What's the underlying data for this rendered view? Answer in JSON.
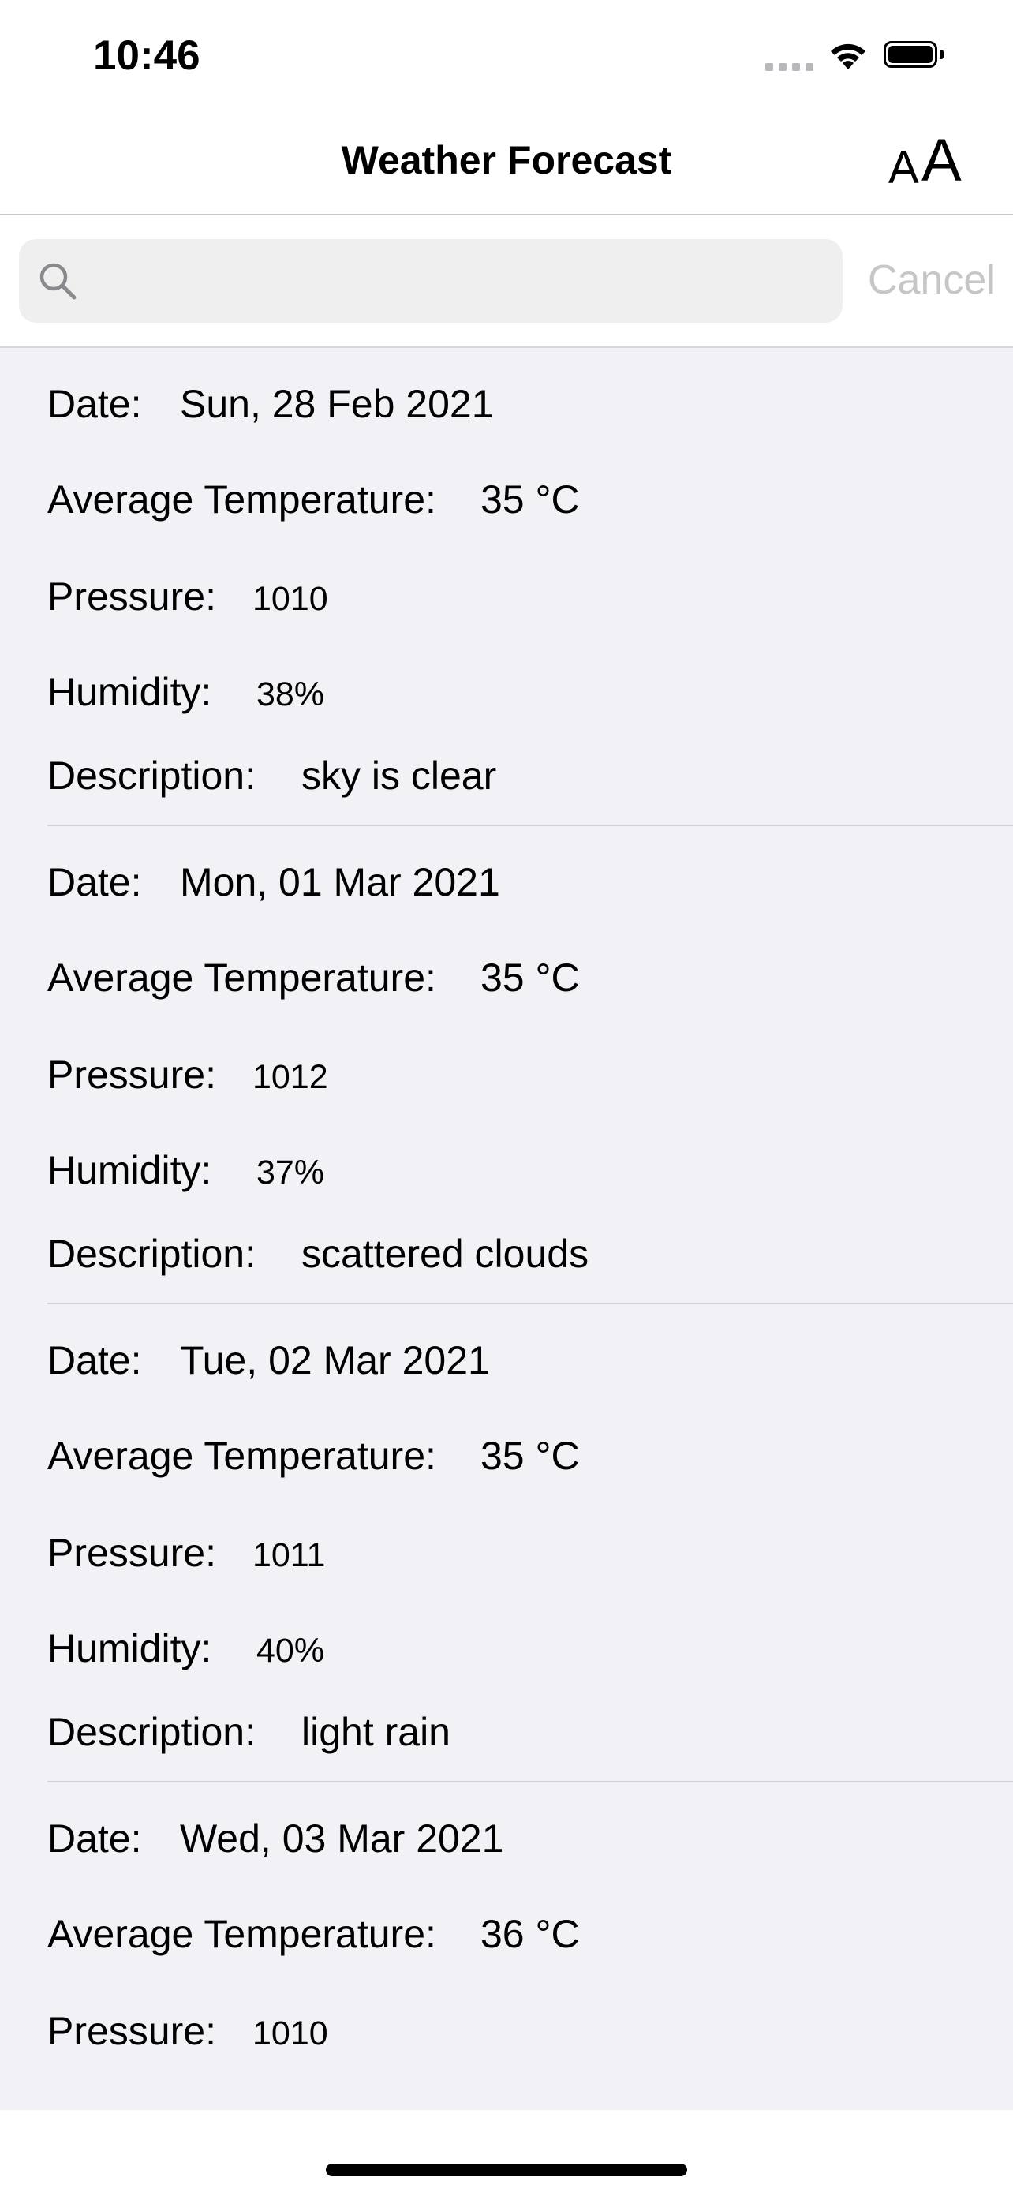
{
  "status_bar": {
    "time": "10:46"
  },
  "nav": {
    "title": "Weather Forecast",
    "font_button": {
      "small": "A",
      "large": "A"
    }
  },
  "search": {
    "placeholder": "",
    "value": "",
    "cancel_label": "Cancel"
  },
  "labels": {
    "date": "Date:",
    "temperature": "Average Temperature:",
    "pressure": "Pressure:",
    "humidity": "Humidity:",
    "description": "Description:"
  },
  "forecasts": [
    {
      "date": "Sun, 28 Feb 2021",
      "temperature": "35 °C",
      "pressure": "1010",
      "humidity": "38%",
      "description": "sky is clear"
    },
    {
      "date": "Mon, 01 Mar 2021",
      "temperature": "35 °C",
      "pressure": "1012",
      "humidity": "37%",
      "description": "scattered clouds"
    },
    {
      "date": "Tue, 02 Mar 2021",
      "temperature": "35 °C",
      "pressure": "1011",
      "humidity": "40%",
      "description": "light rain"
    },
    {
      "date": "Wed, 03 Mar 2021",
      "temperature": "36 °C",
      "pressure": "1010"
    }
  ],
  "colors": {
    "list_background": "#f2f1f6",
    "search_field": "#efeff0",
    "cancel_text": "#c6c6c8",
    "separator": "#d3d3d6"
  },
  "icons": {
    "search": "search-icon",
    "wifi": "wifi-icon",
    "battery": "battery-icon",
    "signal": "cellular-signal-icon"
  }
}
